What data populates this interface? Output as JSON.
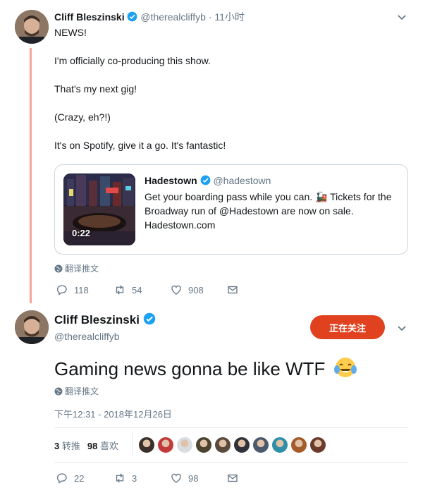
{
  "tweet1": {
    "author_name": "Cliff Bleszinski",
    "author_handle": "@therealcliffyb",
    "time": "· 11小时",
    "lines": [
      "NEWS!",
      "I'm officially co-producing this show.",
      "That's my next gig!",
      "(Crazy, eh?!)",
      "It's on Spotify, give it a go. It's fantastic!"
    ],
    "quote": {
      "author_name": "Hadestown",
      "author_handle": "@hadestown",
      "text": "Get your boarding pass while you can. 🚂 Tickets for the Broadway run of @Hadestown are now on sale. Hadestown.com",
      "video_duration": "0:22"
    },
    "translate_label": "翻译推文",
    "actions": {
      "replies": "118",
      "retweets": "54",
      "likes": "908"
    }
  },
  "tweet2": {
    "author_name": "Cliff Bleszinski",
    "author_handle": "@therealcliffyb",
    "follow_label": "正在关注",
    "text": "Gaming news gonna be like WTF",
    "translate_label": "翻译推文",
    "timestamp": "下午12:31 - 2018年12月26日",
    "stats": {
      "retweets_count": "3",
      "retweets_label": "转推",
      "likes_count": "98",
      "likes_label": "喜欢"
    },
    "likers": [
      "#3b2f2a",
      "#c23b3b",
      "#d8dde2",
      "#4b4330",
      "#5a4a3c",
      "#2f3238",
      "#4a5a6c",
      "#2f8fa8",
      "#a55a2a",
      "#6a3a2a"
    ],
    "actions": {
      "replies": "22",
      "retweets": "3",
      "likes": "98"
    }
  },
  "colors": {
    "thread_line": "#f3a497",
    "follow_button": "#e0421f",
    "verified": "#1da1f2"
  }
}
